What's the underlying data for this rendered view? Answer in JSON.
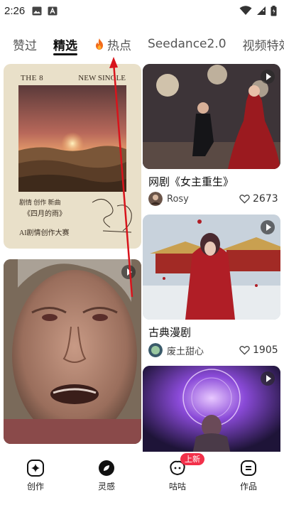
{
  "status_bar": {
    "time": "2:26",
    "icons": [
      "image-icon",
      "a-box-icon",
      "wifi-icon",
      "signal-icon",
      "battery-icon"
    ]
  },
  "tabs": [
    {
      "label": "赞过",
      "active": false
    },
    {
      "label": "精选",
      "active": true
    },
    {
      "label": "热点",
      "active": false,
      "icon": "flame-icon"
    },
    {
      "label": "Seedance2.0",
      "active": false
    },
    {
      "label": "视频特效",
      "active": false
    }
  ],
  "feed": {
    "poster": {
      "top_left": "THE 8",
      "top_right": "NEW SINGLE",
      "caption_1": "《四月的雨》",
      "caption_bottom": "AI剧情创作大赛"
    },
    "card_1": {
      "title": "网剧《女主重生》",
      "author": "Rosy",
      "likes": "2673"
    },
    "card_2": {
      "title": "古典漫剧",
      "author": "废土甜心",
      "likes": "1905"
    }
  },
  "bottom_nav": [
    {
      "label": "创作",
      "icon": "sparkle-icon"
    },
    {
      "label": "灵感",
      "icon": "compass-icon"
    },
    {
      "label": "咕咕",
      "icon": "chat-bubble-icon",
      "badge": "上新"
    },
    {
      "label": "作品",
      "icon": "works-icon"
    }
  ],
  "colors": {
    "accent_red": "#f2304a",
    "arrow_red": "#d8141c",
    "text": "#111111"
  }
}
